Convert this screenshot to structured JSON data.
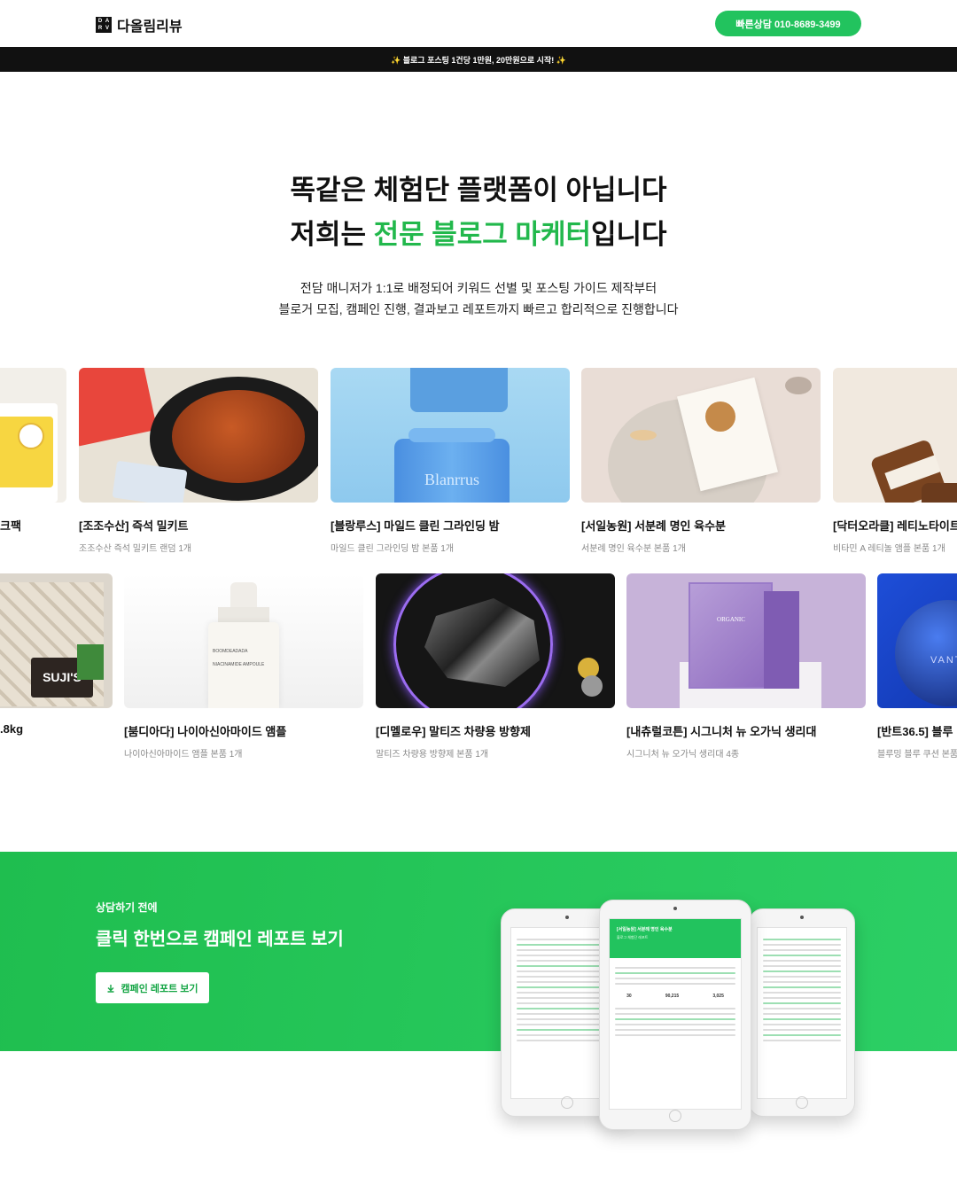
{
  "header": {
    "logo_mark": [
      "D",
      "A",
      "R",
      "V"
    ],
    "logo_text": "다올림리뷰",
    "cta_label": "빠른상담 010-8689-3499"
  },
  "banner": {
    "text": "✨ 블로그 포스팅 1건당 1만원, 20만원으로 시작! ✨"
  },
  "hero": {
    "title_line1": "똑같은 체험단 플랫폼이 아닙니다",
    "title_line2_pre": "저희는 ",
    "title_line2_highlight": "전문 블로그 마케터",
    "title_line2_post": "입니다",
    "desc_line1": "전담 매니저가 1:1로 배정되어 키워드 선별 및 포스팅 가이드 제작부터",
    "desc_line2": "블로거 모집, 캠페인 진행, 결과보고 레포트까지 빠르고 합리적으로 진행합니다"
  },
  "row1": [
    {
      "title": "크팩",
      "sub": ""
    },
    {
      "title": "[조조수산] 즉석 밀키트",
      "sub": "조조수산 즉석 밀키트 랜덤 1개"
    },
    {
      "title": "[블랑루스] 마일드 클린 그라인딩 밤",
      "sub": "마일드 클린 그라인딩 밤 본품 1개"
    },
    {
      "title": "[서일농원] 서분례 명인 육수분",
      "sub": "서분례 명인 육수분 본품 1개"
    },
    {
      "title": "[닥터오라클] 레티노타이트",
      "sub": "비타민 A 레티놀 앰플 본품 1개"
    }
  ],
  "row2": [
    {
      "title": ".8kg",
      "sub": ""
    },
    {
      "title": "[붐디아다] 나이아신아마이드 앰플",
      "sub": "나이아신아마이드 앰플 본품 1개"
    },
    {
      "title": "[디멜로우] 말티즈 차량용 방향제",
      "sub": "말티즈 차량용 방향제 본품 1개"
    },
    {
      "title": "[내츄럴코튼] 시그니처 뉴 오가닉 생리대",
      "sub": "시그니처 뉴 오가닉 생리대 4종"
    },
    {
      "title": "[반트36.5] 블루",
      "sub": "블루밍 블루 쿠션 본품"
    }
  ],
  "product_text": {
    "blanrrus": "Blanrrus",
    "sujis": "SUJI'S",
    "ampoule_brand": "BOOMDEADADA",
    "ampoule_name": "NIACINAMIDE AMPOULE",
    "organic": "ORGANIC",
    "vant": "VANT"
  },
  "consult": {
    "pre_title": "상담하기 전에",
    "title": "클릭 한번으로 캠페인 레포트 보기",
    "button_label": "캠페인 레포트 보기"
  },
  "report_preview": {
    "header_line1": "[서일농원] 서분례 명인 육수분",
    "header_line2": "블로그 체험단 레포트",
    "stat1": "30",
    "stat2": "90,215",
    "stat3": "3,025"
  },
  "colors": {
    "accent": "#22c35e",
    "highlight": "#22b84c",
    "banner_bg": "#111111"
  }
}
